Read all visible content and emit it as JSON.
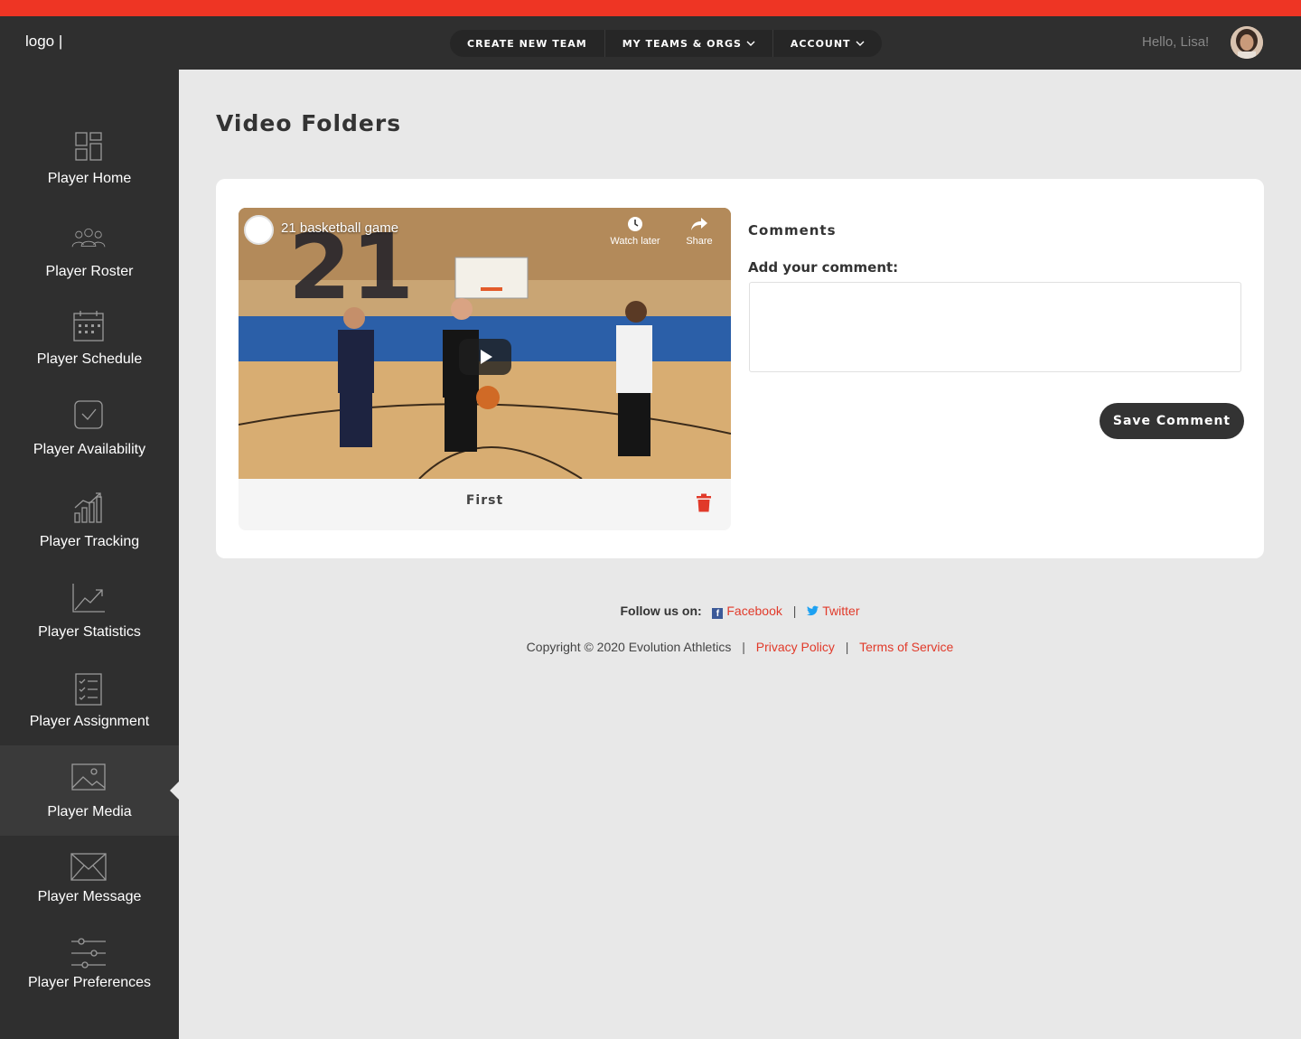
{
  "colors": {
    "accent": "#ee3524",
    "header_bg": "#2f2f2f",
    "link": "#e13a2a",
    "page_bg": "#e8e8e8"
  },
  "header": {
    "logo": "logo |",
    "nav": [
      {
        "label": "CREATE NEW TEAM",
        "dropdown": false
      },
      {
        "label": "MY TEAMS & ORGS",
        "dropdown": true
      },
      {
        "label": "ACCOUNT",
        "dropdown": true
      }
    ],
    "greeting": "Hello, Lisa!"
  },
  "sidebar": {
    "active": "Player Media",
    "items": [
      {
        "label": "Player Home",
        "icon": "dashboard-icon"
      },
      {
        "label": "Player Roster",
        "icon": "group-icon"
      },
      {
        "label": "Player Schedule",
        "icon": "calendar-icon"
      },
      {
        "label": "Player Availability",
        "icon": "checkbox-icon"
      },
      {
        "label": "Player Tracking",
        "icon": "bar-chart-icon"
      },
      {
        "label": "Player Statistics",
        "icon": "trend-icon"
      },
      {
        "label": "Player Assignment",
        "icon": "checklist-icon"
      },
      {
        "label": "Player Media",
        "icon": "image-icon"
      },
      {
        "label": "Player Message",
        "icon": "envelope-icon"
      },
      {
        "label": "Player Preferences",
        "icon": "sliders-icon"
      }
    ]
  },
  "main": {
    "title": "Video Folders",
    "video": {
      "title": "21 basketball game",
      "watch_later": "Watch later",
      "share": "Share",
      "caption": "First"
    },
    "comments": {
      "title": "Comments",
      "label": "Add your comment:",
      "value": "",
      "save_label": "Save Comment"
    }
  },
  "footer": {
    "follow_label": "Follow us on:",
    "facebook": "Facebook",
    "twitter": "Twitter",
    "copyright": "Copyright © 2020 Evolution Athletics",
    "privacy": "Privacy Policy",
    "terms": "Terms of Service",
    "separator": "|"
  }
}
